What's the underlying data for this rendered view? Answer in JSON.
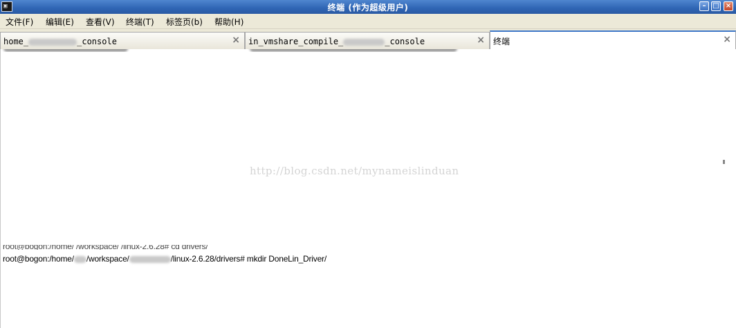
{
  "window": {
    "title": "终端 (作为超级用户)",
    "icon_glyph": "▣",
    "minimize": "–",
    "maximize": "□",
    "close": "×"
  },
  "menu": [
    "文件(F)",
    "编辑(E)",
    "查看(V)",
    "终端(T)",
    "标签页(b)",
    "帮助(H)"
  ],
  "tabs": [
    {
      "prefix": "home_",
      "suffix": "_console",
      "close": "×"
    },
    {
      "prefix": "in_vmshare_compile_",
      "suffix": "_console",
      "close": "×"
    },
    {
      "label": "终端",
      "close": "×"
    }
  ],
  "terminal": {
    "watermark": "http://blog.csdn.net/mynameislinduan",
    "cut_line": "root@bogon:/home/ /workspace/ /linux-2.6.28# cd drivers/",
    "prompt_a": "root@bogon:/home/",
    "prompt_b": "/workspace/",
    "prompt_c": "/linux-2.6.28/drivers# mkdir DoneLin_Driver/"
  },
  "colors": {
    "titlebar": "#2f65b4",
    "menubar": "#ece9d8",
    "active_tab_accent": "#3d77c8"
  }
}
